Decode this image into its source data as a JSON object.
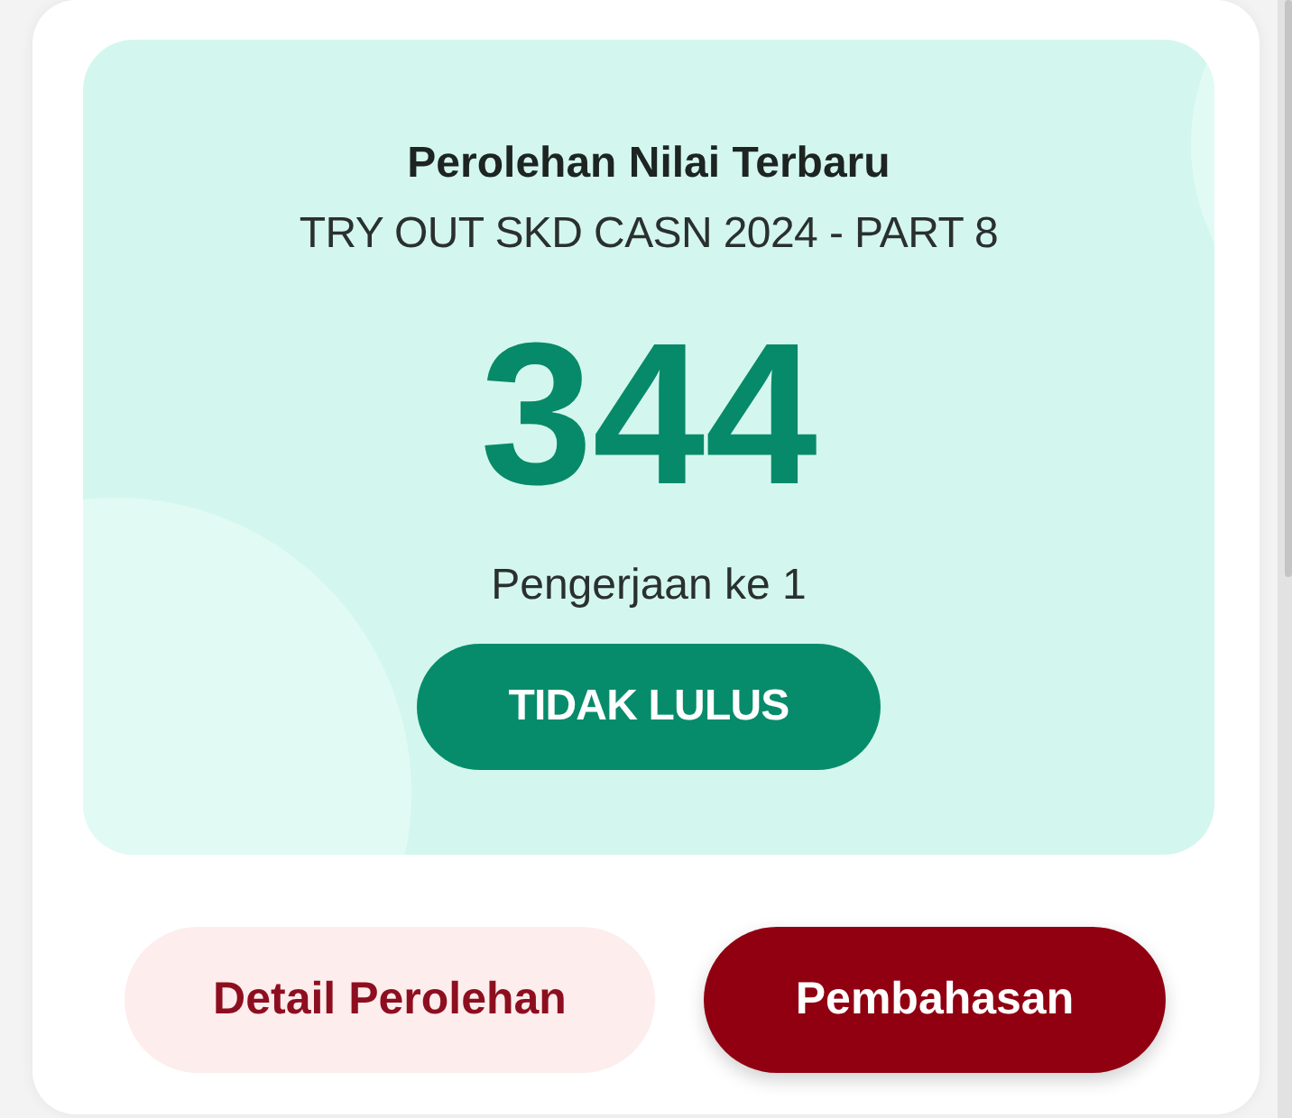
{
  "result_card": {
    "title": "Perolehan Nilai Terbaru",
    "subtitle": "TRY OUT SKD CASN 2024 - PART 8",
    "score": "344",
    "attempt": "Pengerjaan ke 1",
    "status": "TIDAK LULUS"
  },
  "actions": [
    {
      "label": "Detail Perolehan",
      "kind": "secondary"
    },
    {
      "label": "Pembahasan",
      "kind": "primary"
    }
  ]
}
